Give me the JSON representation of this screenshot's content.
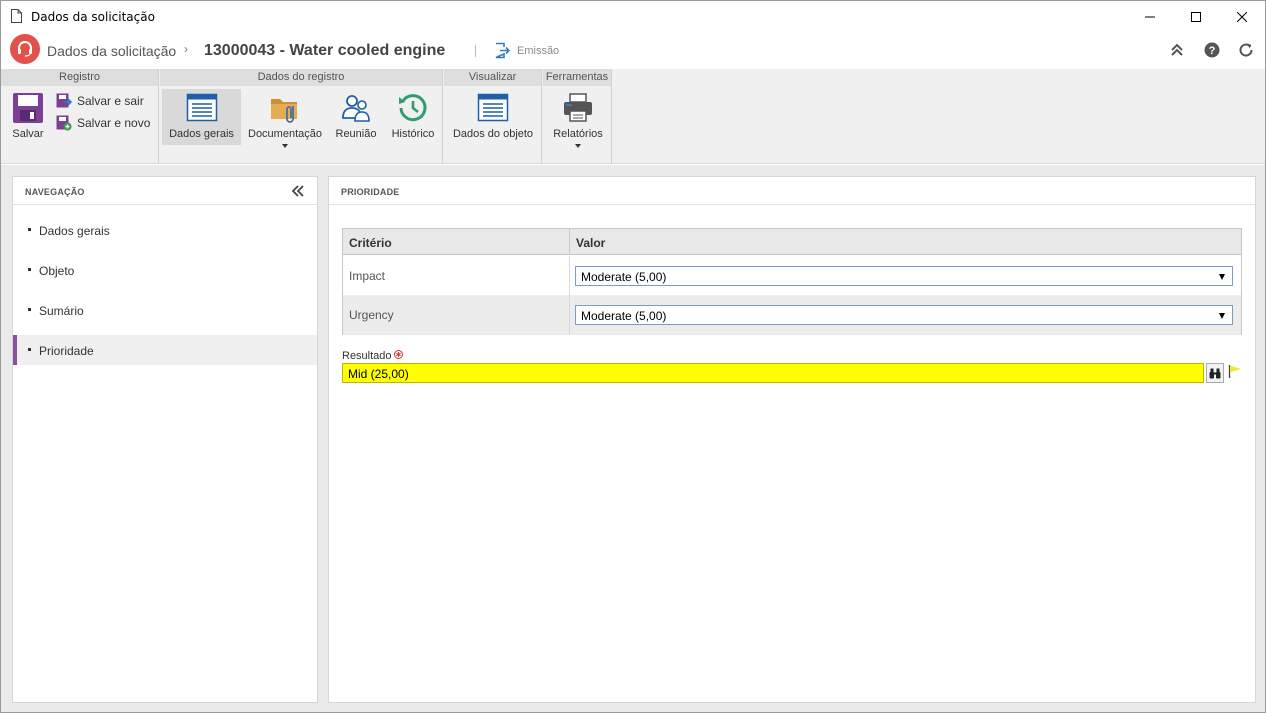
{
  "window": {
    "title": "Dados da solicitação"
  },
  "header": {
    "breadcrumb_root": "Dados da solicitação",
    "record_title": "13000043 - Water cooled engine",
    "stage_label": "Emissão"
  },
  "ribbon": {
    "groups": {
      "registro": "Registro",
      "dados_registro": "Dados do registro",
      "visualizar": "Visualizar",
      "ferramentas": "Ferramentas"
    },
    "buttons": {
      "salvar": "Salvar",
      "salvar_sair": "Salvar e sair",
      "salvar_novo": "Salvar e novo",
      "dados_gerais": "Dados gerais",
      "documentacao": "Documentação",
      "reuniao": "Reunião",
      "historico": "Histórico",
      "dados_objeto": "Dados do objeto",
      "relatorios": "Relatórios"
    }
  },
  "navigation": {
    "title": "NAVEGAÇÃO",
    "items": [
      {
        "label": "Dados gerais",
        "active": false
      },
      {
        "label": "Objeto",
        "active": false
      },
      {
        "label": "Sumário",
        "active": false
      },
      {
        "label": "Prioridade",
        "active": true
      }
    ]
  },
  "main": {
    "title": "PRIORIDADE",
    "grid": {
      "columns": [
        "Critério",
        "Valor"
      ],
      "rows": [
        {
          "criterion": "Impact",
          "value": "Moderate (5,00)"
        },
        {
          "criterion": "Urgency",
          "value": "Moderate (5,00)"
        }
      ]
    },
    "result": {
      "label": "Resultado",
      "value": "Mid (25,00)",
      "highlight_color": "#ffff00"
    }
  },
  "colors": {
    "logo": "#e4504a",
    "active_nav_accent": "#8b4fa0",
    "stage_icon": "#2b7fc2"
  }
}
